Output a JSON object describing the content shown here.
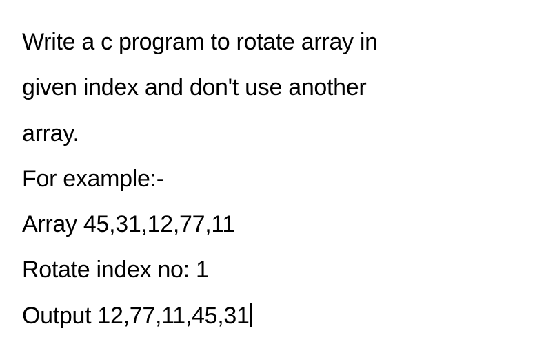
{
  "lines": {
    "line1": "Write a c program to rotate array in",
    "line2": "given index and don't use another",
    "line3": "array.",
    "line4": "For example:-",
    "line5": "Array 45,31,12,77,11",
    "line6": "Rotate index no: 1",
    "line7": "Output 12,77,11,45,31"
  }
}
